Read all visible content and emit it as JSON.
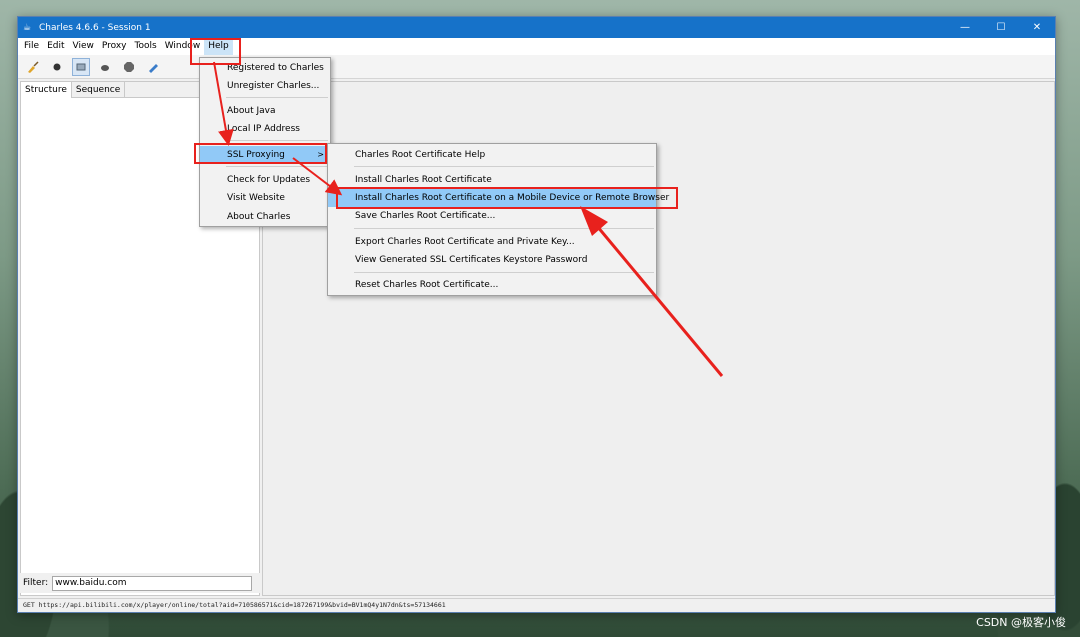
{
  "window": {
    "title": "Charles 4.6.6 - Session 1",
    "controls": [
      "—",
      "☐",
      "✕"
    ]
  },
  "menubar": {
    "items": [
      "File",
      "Edit",
      "View",
      "Proxy",
      "Tools",
      "Window",
      "Help"
    ],
    "active": "Help"
  },
  "toolbar": {
    "icons": [
      "broom-icon",
      "record-icon",
      "throttle-icon",
      "turtle-icon",
      "stop-icon",
      "pen-icon"
    ]
  },
  "left_pane": {
    "tabs": [
      "Structure",
      "Sequence"
    ],
    "active_tab": "Structure"
  },
  "filter": {
    "label": "Filter:",
    "value": "www.baidu.com"
  },
  "help_menu": {
    "items": [
      "Registered to Charles",
      "Unregister Charles...",
      "About Java",
      "Local IP Address",
      "SSL Proxying",
      "Check for Updates",
      "Visit Website",
      "About Charles"
    ],
    "highlighted": "SSL Proxying",
    "submenu_arrow": ">"
  },
  "ssl_menu": {
    "items": [
      "Charles Root Certificate Help",
      "Install Charles Root Certificate",
      "Install Charles Root Certificate on a Mobile Device or Remote Browser",
      "Save Charles Root Certificate...",
      "Export Charles Root Certificate and Private Key...",
      "View Generated SSL Certificates Keystore Password",
      "Reset Charles Root Certificate..."
    ],
    "highlighted": "Install Charles Root Certificate on a Mobile Device or Remote Browser"
  },
  "status": {
    "text": "GET https://api.bilibili.com/x/player/online/total?aid=710586571&cid=187267199&bvid=BV1mQ4y1N7dn&ts=57134661"
  },
  "watermark": "CSDN @极客小俊",
  "colors": {
    "annotation": "#e8211d",
    "highlight": "#91c9f7",
    "titlebar": "#1672c9"
  }
}
